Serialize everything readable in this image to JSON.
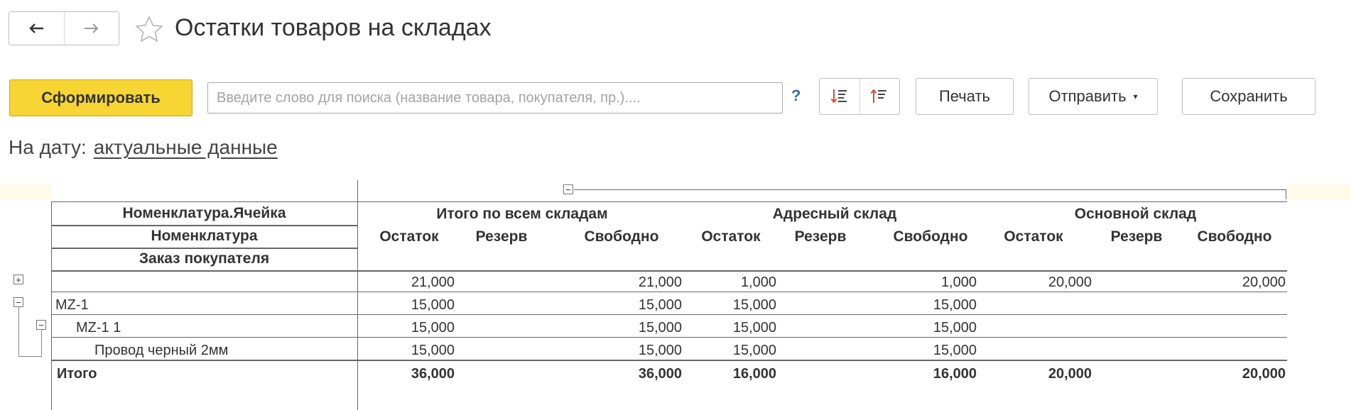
{
  "header": {
    "title": "Остатки товаров на складах",
    "back_icon": "←",
    "forward_icon": "→",
    "star_icon": "star-outline"
  },
  "toolbar": {
    "generate_label": "Сформировать",
    "search_placeholder": "Введите слово для поиска (название товара, покупателя, пр.)....",
    "search_value": "",
    "help_label": "?",
    "print_label": "Печать",
    "send_label": "Отправить",
    "send_caret": "▾",
    "save_label": "Сохранить"
  },
  "filter": {
    "date_label": "На дату:",
    "date_value": "актуальные данные"
  },
  "report": {
    "collapse_all": "−",
    "row_headers": [
      "Номенклатура.Ячейка",
      "Номенклатура",
      "Заказ покупателя"
    ],
    "groups": [
      "Итого по всем складам",
      "Адресный склад",
      "Основной склад"
    ],
    "subcols": [
      "Остаток",
      "Резерв",
      "Свободно",
      "Остаток",
      "Резерв",
      "Свободно",
      "Остаток",
      "Резерв",
      "Свободно"
    ],
    "rows": [
      {
        "toggle": "+",
        "label": "",
        "values": [
          "21,000",
          "",
          "21,000",
          "1,000",
          "",
          "1,000",
          "20,000",
          "",
          "20,000"
        ]
      },
      {
        "toggle": "−",
        "label": "MZ-1",
        "values": [
          "15,000",
          "",
          "15,000",
          "15,000",
          "",
          "15,000",
          "",
          "",
          ""
        ]
      },
      {
        "toggle": "−",
        "label": "MZ-1 1",
        "values": [
          "15,000",
          "",
          "15,000",
          "15,000",
          "",
          "15,000",
          "",
          "",
          ""
        ]
      },
      {
        "toggle": "",
        "label": "Провод черный 2мм",
        "values": [
          "15,000",
          "",
          "15,000",
          "15,000",
          "",
          "15,000",
          "",
          "",
          ""
        ]
      }
    ],
    "total": {
      "label": "Итого",
      "values": [
        "36,000",
        "",
        "36,000",
        "16,000",
        "",
        "16,000",
        "20,000",
        "",
        "20,000"
      ]
    }
  },
  "colors": {
    "accent": "#f7d532",
    "link": "#3a66b1",
    "band": "#fefbe8"
  }
}
